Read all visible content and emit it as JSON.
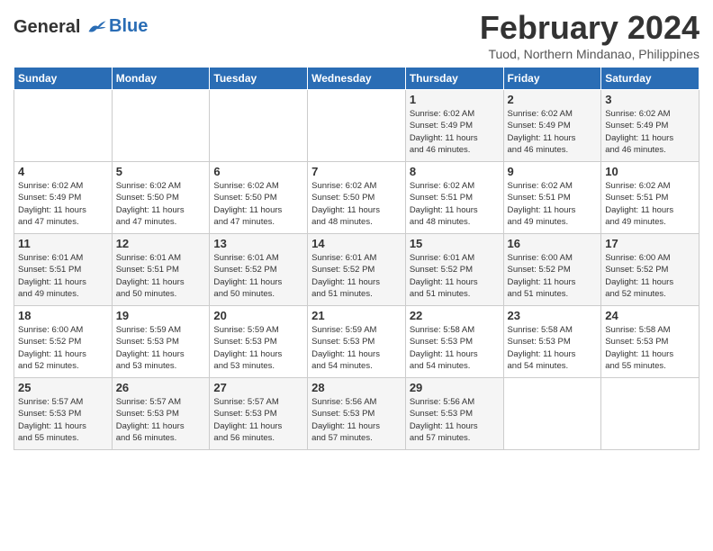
{
  "header": {
    "logo_line1": "General",
    "logo_line2": "Blue",
    "month_year": "February 2024",
    "location": "Tuod, Northern Mindanao, Philippines"
  },
  "days_of_week": [
    "Sunday",
    "Monday",
    "Tuesday",
    "Wednesday",
    "Thursday",
    "Friday",
    "Saturday"
  ],
  "weeks": [
    [
      {
        "day": "",
        "info": ""
      },
      {
        "day": "",
        "info": ""
      },
      {
        "day": "",
        "info": ""
      },
      {
        "day": "",
        "info": ""
      },
      {
        "day": "1",
        "info": "Sunrise: 6:02 AM\nSunset: 5:49 PM\nDaylight: 11 hours\nand 46 minutes."
      },
      {
        "day": "2",
        "info": "Sunrise: 6:02 AM\nSunset: 5:49 PM\nDaylight: 11 hours\nand 46 minutes."
      },
      {
        "day": "3",
        "info": "Sunrise: 6:02 AM\nSunset: 5:49 PM\nDaylight: 11 hours\nand 46 minutes."
      }
    ],
    [
      {
        "day": "4",
        "info": "Sunrise: 6:02 AM\nSunset: 5:49 PM\nDaylight: 11 hours\nand 47 minutes."
      },
      {
        "day": "5",
        "info": "Sunrise: 6:02 AM\nSunset: 5:50 PM\nDaylight: 11 hours\nand 47 minutes."
      },
      {
        "day": "6",
        "info": "Sunrise: 6:02 AM\nSunset: 5:50 PM\nDaylight: 11 hours\nand 47 minutes."
      },
      {
        "day": "7",
        "info": "Sunrise: 6:02 AM\nSunset: 5:50 PM\nDaylight: 11 hours\nand 48 minutes."
      },
      {
        "day": "8",
        "info": "Sunrise: 6:02 AM\nSunset: 5:51 PM\nDaylight: 11 hours\nand 48 minutes."
      },
      {
        "day": "9",
        "info": "Sunrise: 6:02 AM\nSunset: 5:51 PM\nDaylight: 11 hours\nand 49 minutes."
      },
      {
        "day": "10",
        "info": "Sunrise: 6:02 AM\nSunset: 5:51 PM\nDaylight: 11 hours\nand 49 minutes."
      }
    ],
    [
      {
        "day": "11",
        "info": "Sunrise: 6:01 AM\nSunset: 5:51 PM\nDaylight: 11 hours\nand 49 minutes."
      },
      {
        "day": "12",
        "info": "Sunrise: 6:01 AM\nSunset: 5:51 PM\nDaylight: 11 hours\nand 50 minutes."
      },
      {
        "day": "13",
        "info": "Sunrise: 6:01 AM\nSunset: 5:52 PM\nDaylight: 11 hours\nand 50 minutes."
      },
      {
        "day": "14",
        "info": "Sunrise: 6:01 AM\nSunset: 5:52 PM\nDaylight: 11 hours\nand 51 minutes."
      },
      {
        "day": "15",
        "info": "Sunrise: 6:01 AM\nSunset: 5:52 PM\nDaylight: 11 hours\nand 51 minutes."
      },
      {
        "day": "16",
        "info": "Sunrise: 6:00 AM\nSunset: 5:52 PM\nDaylight: 11 hours\nand 51 minutes."
      },
      {
        "day": "17",
        "info": "Sunrise: 6:00 AM\nSunset: 5:52 PM\nDaylight: 11 hours\nand 52 minutes."
      }
    ],
    [
      {
        "day": "18",
        "info": "Sunrise: 6:00 AM\nSunset: 5:52 PM\nDaylight: 11 hours\nand 52 minutes."
      },
      {
        "day": "19",
        "info": "Sunrise: 5:59 AM\nSunset: 5:53 PM\nDaylight: 11 hours\nand 53 minutes."
      },
      {
        "day": "20",
        "info": "Sunrise: 5:59 AM\nSunset: 5:53 PM\nDaylight: 11 hours\nand 53 minutes."
      },
      {
        "day": "21",
        "info": "Sunrise: 5:59 AM\nSunset: 5:53 PM\nDaylight: 11 hours\nand 54 minutes."
      },
      {
        "day": "22",
        "info": "Sunrise: 5:58 AM\nSunset: 5:53 PM\nDaylight: 11 hours\nand 54 minutes."
      },
      {
        "day": "23",
        "info": "Sunrise: 5:58 AM\nSunset: 5:53 PM\nDaylight: 11 hours\nand 54 minutes."
      },
      {
        "day": "24",
        "info": "Sunrise: 5:58 AM\nSunset: 5:53 PM\nDaylight: 11 hours\nand 55 minutes."
      }
    ],
    [
      {
        "day": "25",
        "info": "Sunrise: 5:57 AM\nSunset: 5:53 PM\nDaylight: 11 hours\nand 55 minutes."
      },
      {
        "day": "26",
        "info": "Sunrise: 5:57 AM\nSunset: 5:53 PM\nDaylight: 11 hours\nand 56 minutes."
      },
      {
        "day": "27",
        "info": "Sunrise: 5:57 AM\nSunset: 5:53 PM\nDaylight: 11 hours\nand 56 minutes."
      },
      {
        "day": "28",
        "info": "Sunrise: 5:56 AM\nSunset: 5:53 PM\nDaylight: 11 hours\nand 57 minutes."
      },
      {
        "day": "29",
        "info": "Sunrise: 5:56 AM\nSunset: 5:53 PM\nDaylight: 11 hours\nand 57 minutes."
      },
      {
        "day": "",
        "info": ""
      },
      {
        "day": "",
        "info": ""
      }
    ]
  ]
}
